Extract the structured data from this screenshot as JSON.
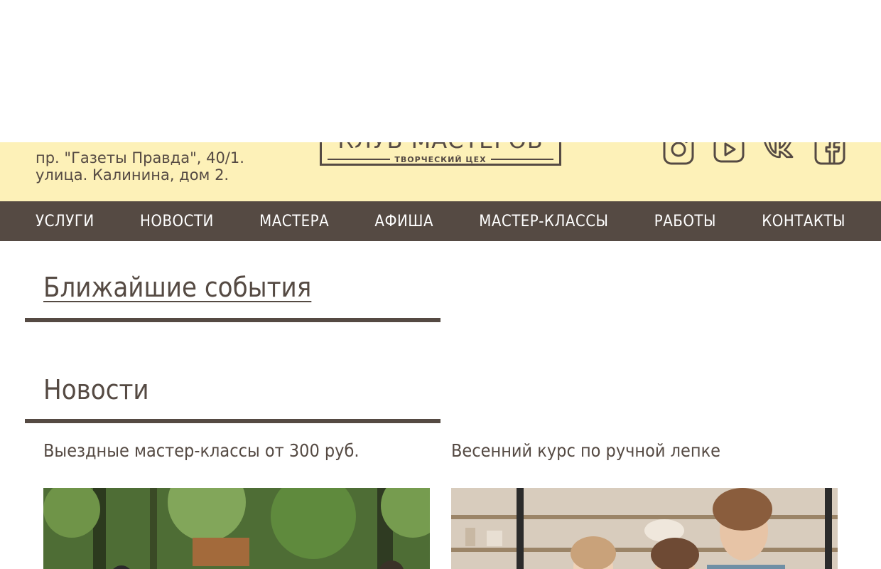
{
  "header": {
    "address_line1": "пр. \"Газеты Правда\", 40/1.",
    "address_line2": "улица. Калинина, дом 2.",
    "logo_title": "КЛУБ МАСТЕРОВ",
    "logo_subtitle": "ТВОРЧЕСКИЙ ЦЕХ",
    "socials": [
      {
        "name": "instagram-icon"
      },
      {
        "name": "youtube-icon"
      },
      {
        "name": "vk-icon"
      },
      {
        "name": "facebook-icon"
      }
    ]
  },
  "nav": {
    "items": [
      {
        "label": "УСЛУГИ"
      },
      {
        "label": "НОВОСТИ"
      },
      {
        "label": "МАСТЕРА"
      },
      {
        "label": "АФИША"
      },
      {
        "label": "МАСТЕР-КЛАССЫ"
      },
      {
        "label": "РАБОТЫ"
      },
      {
        "label": "КОНТАКТЫ"
      }
    ]
  },
  "events": {
    "title": "Ближайшие события"
  },
  "news": {
    "title": "Новости",
    "items": [
      {
        "title": "Выездные мастер-классы от 300 руб."
      },
      {
        "title": "Весенний курс по ручной лепке"
      }
    ]
  },
  "colors": {
    "brand_dark": "#554a43",
    "header_bg": "#fdf1b8",
    "background": "#ffffff"
  }
}
